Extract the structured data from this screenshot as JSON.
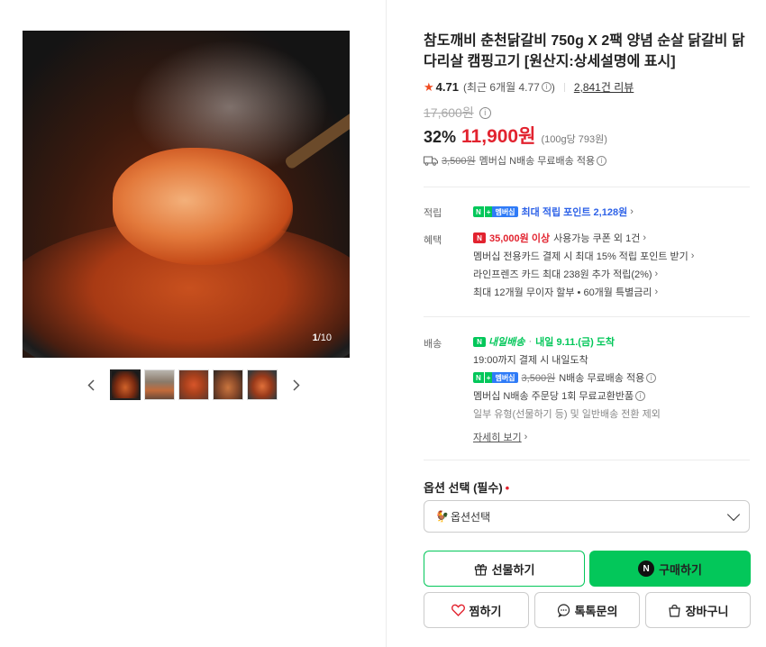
{
  "gallery": {
    "counter_current": "1",
    "counter_total": "/10",
    "prev_icon": "chevron-left-icon",
    "next_icon": "chevron-right-icon",
    "thumb_count": 5
  },
  "product": {
    "title": "참도깨비 춘천닭갈비 750g X 2팩 양념 순살 닭갈비 닭다리살 캠핑고기 [원산지:상세설명에 표시]",
    "rating": "4.71",
    "rating_recent": "(최근 6개월 4.77",
    "rating_recent_close": ")",
    "review_count": "2,841건 리뷰",
    "original_price": "17,600원",
    "discount": "32%",
    "price": "11,900원",
    "unit_price": "(100g당 793원)",
    "shipping_fee": "3,500원",
    "shipping_text": "멤버십 N배송 무료배송 적용"
  },
  "benefits": {
    "point_label": "적립",
    "point_badge_n": "N",
    "point_badge_plus": "+",
    "point_badge_m": "멤버십",
    "point_text": "최대 적립 포인트 2,128원",
    "benefit_label": "혜택",
    "coupon_badge": "N",
    "coupon_amount": "35,000원 이상",
    "coupon_text": "사용가능 쿠폰 외 1건",
    "card_text": "멤버십 전용카드 결제 시 최대 15% 적립 포인트 받기",
    "linefriends_text": "라인프렌즈 카드 최대 238원 추가 적립(2%)",
    "installment_text": "최대 12개월 무이자 할부 • 60개월 특별금리"
  },
  "delivery": {
    "label": "배송",
    "tomorrow_badge": "N",
    "tomorrow_text": "내일배송",
    "arrival_dot": "·",
    "arrival": "내일 9.11.(금) 도착",
    "cutoff": "19:00까지 결제 시 내일도착",
    "fee": "3,500원",
    "fee_text": "N배송 무료배송 적용",
    "exchange": "멤버십 N배송 주문당 1회 무료교환반품",
    "exclusion": "일부 유형(선물하기 등) 및 일반배송 전환 제외",
    "detail_link": "자세히 보기"
  },
  "options": {
    "label": "옵션 선택 (필수)",
    "required_mark": "•",
    "select_value": "옵션선택"
  },
  "buttons": {
    "gift": "선물하기",
    "buy": "구매하기",
    "buy_badge": "N",
    "wish": "찜하기",
    "talk": "톡톡문의",
    "cart": "장바구니"
  },
  "colors": {
    "accent_green": "#03c75a",
    "price_red": "#e2232f",
    "point_blue": "#2f63e8"
  }
}
